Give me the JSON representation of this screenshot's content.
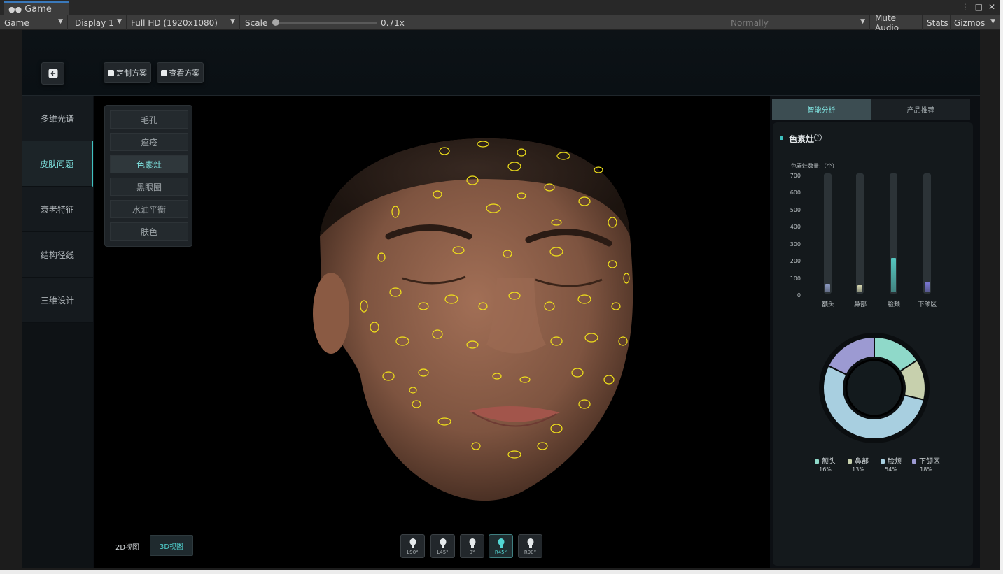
{
  "editor": {
    "tab_title": "Game",
    "toolbar": {
      "game_select": "Game",
      "display_select": "Display 1",
      "resolution_select": "Full HD (1920x1080)",
      "scale_label": "Scale",
      "scale_value": "0.71x",
      "scale_fraction": 0.0,
      "play_mode": "Normally",
      "mute_audio": "Mute Audio",
      "stats": "Stats",
      "gizmos": "Gizmos"
    }
  },
  "header": {
    "back_icon": "arrow-left-icon",
    "customize_label": "定制方案",
    "view_plan_label": "查看方案"
  },
  "nav": {
    "items": [
      {
        "label": "多维光谱",
        "active": false
      },
      {
        "label": "皮肤问题",
        "active": true
      },
      {
        "label": "衰老特征",
        "active": false
      },
      {
        "label": "结构径线",
        "active": false
      },
      {
        "label": "三维设计",
        "active": false
      }
    ]
  },
  "submenu": {
    "items": [
      {
        "label": "毛孔",
        "active": false
      },
      {
        "label": "痤疮",
        "active": false
      },
      {
        "label": "色素灶",
        "active": true
      },
      {
        "label": "黑眼圈",
        "active": false
      },
      {
        "label": "水油平衡",
        "active": false
      },
      {
        "label": "肤色",
        "active": false
      }
    ]
  },
  "view": {
    "mode_2d": "2D视图",
    "mode_3d": "3D视图",
    "angles": [
      {
        "label": "L90°",
        "active": false
      },
      {
        "label": "L45°",
        "active": false
      },
      {
        "label": "0°",
        "active": false
      },
      {
        "label": "R45°",
        "active": true
      },
      {
        "label": "R90°",
        "active": false
      }
    ]
  },
  "panel": {
    "tabs": [
      {
        "label": "智能分析",
        "active": true
      },
      {
        "label": "产品推荐",
        "active": false
      }
    ],
    "title": "色素灶",
    "help_icon": "question-circle-icon"
  },
  "chart_data": [
    {
      "type": "bar",
      "title": "色素灶数量:（个）",
      "categories": [
        "额头",
        "鼻部",
        "脸颊",
        "下颌区"
      ],
      "values": [
        50,
        40,
        200,
        60
      ],
      "ylim": [
        0,
        700
      ],
      "yticks": [
        "0",
        "100",
        "200",
        "300",
        "400",
        "500",
        "600",
        "700"
      ],
      "colors": [
        "#8e9bc4",
        "#d6d6b0",
        "#55c7c0",
        "#7b78d6"
      ]
    },
    {
      "type": "pie",
      "categories": [
        "额头",
        "鼻部",
        "脸颊",
        "下颌区"
      ],
      "values": [
        16,
        13,
        54,
        18
      ],
      "labels": [
        "16%",
        "13%",
        "54%",
        "18%"
      ],
      "colors": [
        "#8fd9c9",
        "#c7d0ad",
        "#a8cfe0",
        "#9c9ad2"
      ],
      "legend": "bottom"
    }
  ]
}
